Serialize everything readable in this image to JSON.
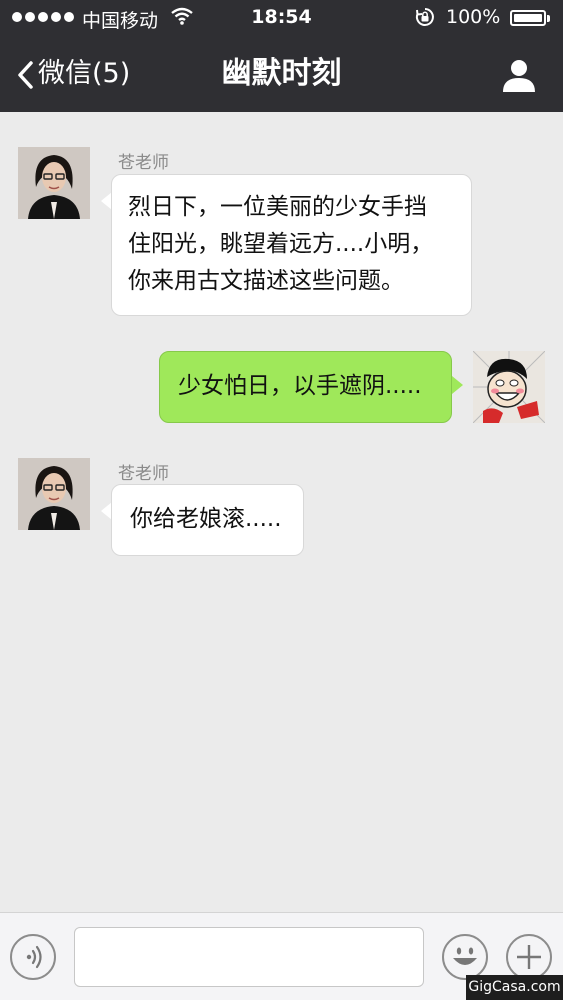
{
  "status_bar": {
    "carrier": "中国移动",
    "time": "18:54",
    "battery_percent": "100%",
    "signal_dots": 5
  },
  "nav": {
    "back_label": "微信",
    "unread_count": "(5)",
    "title": "幽默时刻"
  },
  "messages": [
    {
      "direction": "incoming",
      "sender": "苍老师",
      "lines": [
        "烈日下，一位美丽的少女手挡",
        "住阳光，眺望着远方....小明，",
        "你来用古文描述这些问题。"
      ]
    },
    {
      "direction": "outgoing",
      "lines": [
        "少女怕日，以手遮阴....."
      ]
    },
    {
      "direction": "incoming",
      "sender": "苍老师",
      "lines": [
        "你给老娘滚....."
      ]
    }
  ],
  "composer": {
    "input_value": ""
  },
  "watermark": "GigCasa.com",
  "colors": {
    "header_bg": "#2f2f33",
    "chat_bg": "#ebebeb",
    "outgoing_bubble": "#9fe85a",
    "incoming_bubble": "#ffffff"
  }
}
